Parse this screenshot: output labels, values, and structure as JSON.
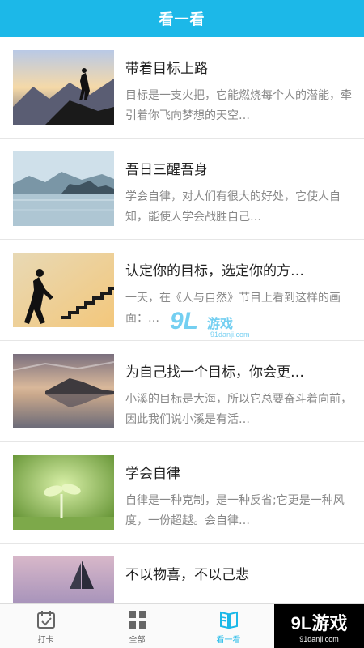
{
  "header": {
    "title": "看一看"
  },
  "items": [
    {
      "title": "带着目标上路",
      "desc": "目标是一支火把，它能燃烧每个人的潜能，牵引着你飞向梦想的天空…",
      "image": "hiker-on-mountain"
    },
    {
      "title": "吾日三醒吾身",
      "desc": "学会自律，对人们有很大的好处，它使人自知，能使人学会战胜自己…",
      "image": "lake-mountains"
    },
    {
      "title": "认定你的目标，选定你的方…",
      "desc": "一天，在《人与自然》节目上看到这样的画面：…",
      "image": "man-climbing-stairs"
    },
    {
      "title": "为自己找一个目标，你会更…",
      "desc": "小溪的目标是大海，所以它总要奋斗着向前，因此我们说小溪是有活…",
      "image": "island-reflection"
    },
    {
      "title": "学会自律",
      "desc": "自律是一种克制，是一种反省;它更是一种风度，一份超越。会自律…",
      "image": "green-sprout"
    },
    {
      "title": "不以物喜，不以己悲",
      "desc": "",
      "image": "sailboat-sunset"
    }
  ],
  "tabbar": {
    "tabs": [
      {
        "label": "打卡",
        "icon": "calendar-check-icon"
      },
      {
        "label": "全部",
        "icon": "grid-icon"
      },
      {
        "label": "看一看",
        "icon": "book-icon"
      }
    ],
    "active_index": 2
  },
  "watermark": {
    "logo": "9L",
    "name": "游戏",
    "url": "91danji.com"
  },
  "colors": {
    "accent": "#1cb8e8"
  }
}
